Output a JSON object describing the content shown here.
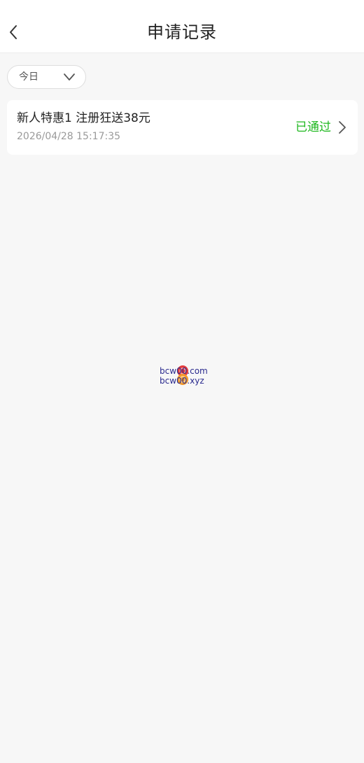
{
  "header": {
    "title": "申请记录",
    "back_icon": "chevron-left-icon"
  },
  "filter": {
    "selected": "今日",
    "icon": "chevron-down-icon"
  },
  "records": [
    {
      "title": "新人特惠1 注册狂送38元",
      "time": "2026/04/28 15:17:35",
      "status": "已通过",
      "status_color": "#1fb81f"
    }
  ],
  "watermark": {
    "line1": "bcw00.com",
    "line2": "bcw00.xyz"
  }
}
